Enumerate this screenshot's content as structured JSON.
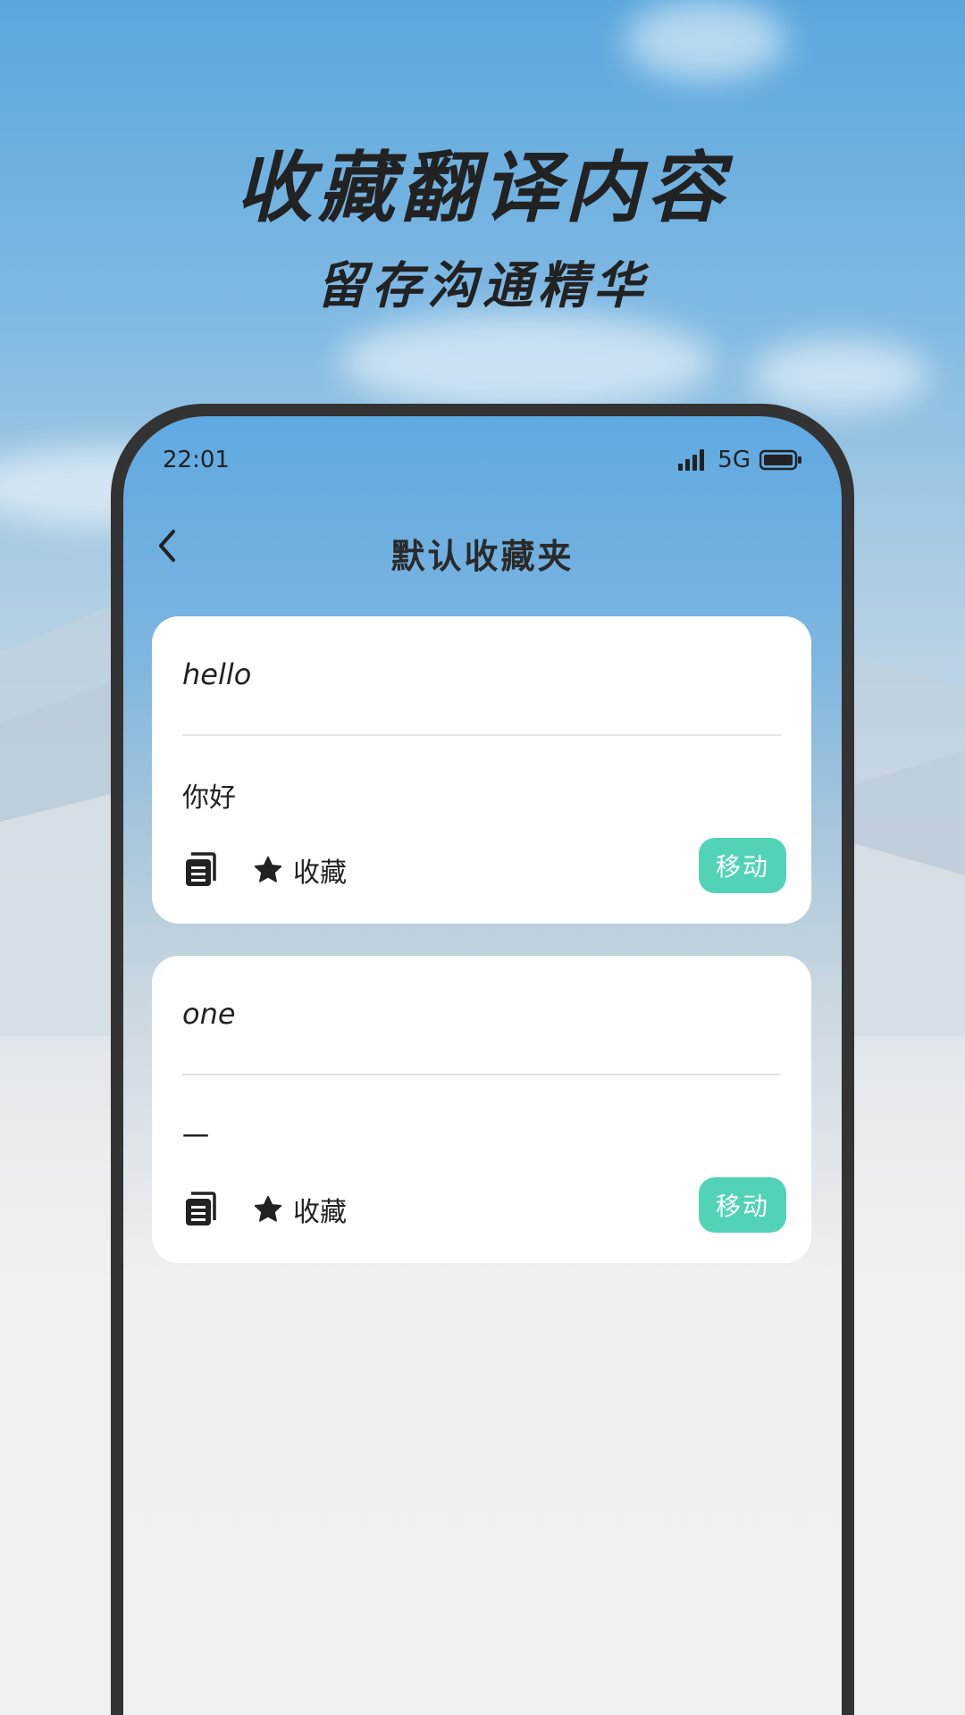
{
  "promo": {
    "headline": "收藏翻译内容",
    "subheadline": "留存沟通精华"
  },
  "status_bar": {
    "time": "22:01",
    "network": "5G",
    "icons": [
      "signal-icon",
      "battery-icon"
    ]
  },
  "nav": {
    "title": "默认收藏夹",
    "back_icon": "chevron-left-icon"
  },
  "cards": [
    {
      "source": "hello",
      "translation": "你好",
      "favorite_label": "收藏",
      "move_label": "移动"
    },
    {
      "source": "one",
      "translation": "一",
      "favorite_label": "收藏",
      "move_label": "移动"
    }
  ],
  "card_icons": [
    "copy-icon",
    "star-icon"
  ],
  "colors": {
    "accent": "#52d3b8",
    "phone_frame": "#333333",
    "text": "#222222"
  }
}
